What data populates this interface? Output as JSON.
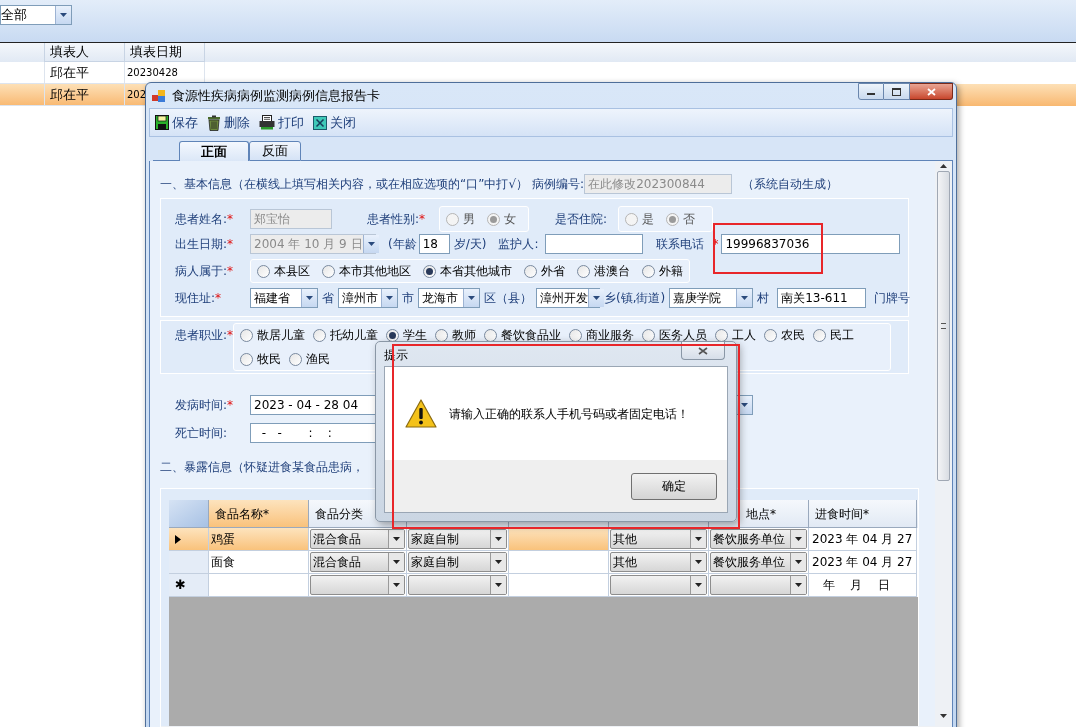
{
  "background_app": {
    "filter": {
      "value": "全部"
    },
    "columns": [
      {
        "label": "填表人"
      },
      {
        "label": "填表日期"
      }
    ],
    "rows": [
      {
        "filler": "邱在平",
        "date": "20230428",
        "selected": false
      },
      {
        "filler": "邱在平",
        "date": "202",
        "selected": true
      }
    ]
  },
  "window": {
    "title": "食源性疾病病例监测病例信息报告卡"
  },
  "toolbar": [
    {
      "kind": "save",
      "label": "保存"
    },
    {
      "kind": "delete",
      "label": "删除"
    },
    {
      "kind": "print",
      "label": "打印"
    },
    {
      "kind": "close",
      "label": "关闭"
    }
  ],
  "tabs": [
    {
      "label": "正面",
      "selected": true
    },
    {
      "label": "反面",
      "selected": false
    }
  ],
  "section1": {
    "heading": "一、基本信息（在横线上填写相关内容，或在相应选项的“口”中打√）",
    "case_no_label": "病例编号:",
    "case_no": "在此修改202300844",
    "case_no_note": "（系统自动生成）"
  },
  "patient": {
    "name": {
      "label": "患者姓名:",
      "mark": "*",
      "value": "郑宝怡",
      "disabled": true
    },
    "sex": {
      "label": "患者性别:",
      "mark": "*",
      "disabled": true,
      "options": [
        {
          "label": "男",
          "selected": false
        },
        {
          "label": "女",
          "selected": true
        }
      ]
    },
    "hospitalized": {
      "label": "是否住院:",
      "disabled": true,
      "options": [
        {
          "label": "是",
          "selected": false
        },
        {
          "label": "否",
          "selected": true
        }
      ]
    },
    "birth_date": {
      "label": "出生日期:",
      "mark": "*",
      "value": "2004 年 10 月 9 日",
      "disabled": true
    },
    "age": {
      "prefix": "(年龄",
      "value": "18",
      "suffix": "岁/天)"
    },
    "guardian": {
      "label": "监护人:"
    },
    "phone": {
      "label": "联系电话",
      "mark": "*",
      "value": "19996837036"
    },
    "belongs": {
      "label": "病人属于:",
      "mark": "*",
      "options": [
        {
          "label": "本县区",
          "selected": false
        },
        {
          "label": "本市其他地区",
          "selected": false
        },
        {
          "label": "本省其他城市",
          "selected": true
        },
        {
          "label": "外省",
          "selected": false
        },
        {
          "label": "港澳台",
          "selected": false
        },
        {
          "label": "外籍",
          "selected": false
        }
      ]
    },
    "address": {
      "label": "现住址:",
      "mark": "*",
      "parts": [
        {
          "value": "福建省",
          "unit": "省"
        },
        {
          "value": "漳州市",
          "unit": "市"
        },
        {
          "value": "龙海市",
          "unit": "区（县）"
        },
        {
          "value": "漳州开发",
          "unit": "乡(镇,街道)"
        },
        {
          "value": "嘉庚学院",
          "unit": "村"
        }
      ],
      "house": {
        "value": "南关13-611",
        "unit": "门牌号"
      }
    },
    "occupation": {
      "label": "患者职业:",
      "mark": "*",
      "options": [
        {
          "label": "散居儿童",
          "selected": false
        },
        {
          "label": "托幼儿童",
          "selected": false
        },
        {
          "label": "学生",
          "selected": true
        },
        {
          "label": "教师",
          "selected": false
        },
        {
          "label": "餐饮食品业",
          "selected": false
        },
        {
          "label": "商业服务",
          "selected": false
        },
        {
          "label": "医务人员",
          "selected": false
        },
        {
          "label": "工人",
          "selected": false
        },
        {
          "label": "农民",
          "selected": false
        },
        {
          "label": "民工",
          "selected": false
        },
        {
          "label": "牧民",
          "selected": false
        },
        {
          "label": "渔民",
          "selected": false
        }
      ]
    },
    "onset": {
      "label": "发病时间:",
      "mark": "*",
      "value": "2023 - 04 - 28   04"
    },
    "death": {
      "label": "死亡时间:",
      "value": "  -   -       :    :"
    }
  },
  "exposure": {
    "heading": "二、暴露信息（怀疑进食某食品患病，",
    "columns": {
      "column_1": {
        "label": "食品名称*",
        "selected": true
      },
      "column_2": {
        "label": "食品分类",
        "selected": false
      },
      "column_6": {
        "label": "地点*",
        "selected": false
      },
      "column_7": {
        "label": "进食时间*",
        "selected": false
      }
    },
    "rows": [
      {
        "kind": "data",
        "selected": true,
        "column_1": "鸡蛋",
        "column_2": "混合食品",
        "column_3": "家庭自制",
        "column_5": "其他",
        "column_6": "餐饮服务单位",
        "column_7": "2023 年 04 月 27"
      },
      {
        "kind": "data",
        "selected": false,
        "column_1": "面食",
        "column_2": "混合食品",
        "column_3": "家庭自制",
        "column_5": "其他",
        "column_6": "餐饮服务单位",
        "column_7": "2023 年 04 月 27"
      },
      {
        "kind": "new",
        "selected": false,
        "marker": "✱",
        "column_7": "年    月    日"
      }
    ]
  },
  "dialog": {
    "title": "提示",
    "message": "请输入正确的联系人手机号码或者固定电话！",
    "button": "确定"
  }
}
